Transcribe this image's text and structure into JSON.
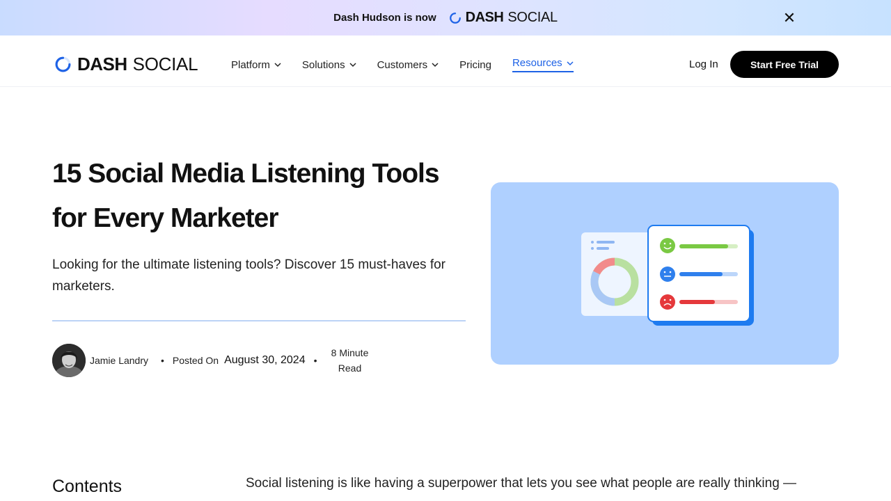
{
  "announcement": {
    "text": "Dash Hudson is now",
    "brand_bold": "DASH",
    "brand_light": "SOCIAL",
    "close_glyph": "✕"
  },
  "nav": {
    "brand_bold": "DASH",
    "brand_light": "SOCIAL",
    "menu": [
      {
        "label": "Platform",
        "has_dropdown": true
      },
      {
        "label": "Solutions",
        "has_dropdown": true
      },
      {
        "label": "Customers",
        "has_dropdown": true
      },
      {
        "label": "Pricing",
        "has_dropdown": false
      },
      {
        "label": "Resources",
        "has_dropdown": true,
        "active": true
      }
    ],
    "login": "Log In",
    "cta": "Start Free Trial"
  },
  "article": {
    "title": "15 Social Media Listening Tools for Every Marketer",
    "subtitle": "Looking for the ultimate listening tools? Discover 15 must-haves for marketers.",
    "author": "Jamie Landry",
    "posted_label": "Posted On",
    "posted_date": "August 30, 2024",
    "read_time": "8 Minute Read",
    "contents_heading": "Contents",
    "intro": "Social listening is like having a superpower that lets you see what people are really thinking —"
  },
  "colors": {
    "accent": "#1e62e6",
    "hero_bg": "#afd0ff",
    "positive": "#7ac943",
    "neutral": "#2f80ed",
    "negative": "#e5383b"
  },
  "icons": {
    "logo": "dash-ring-icon",
    "chevron": "chevron-down-icon",
    "close": "close-icon"
  }
}
